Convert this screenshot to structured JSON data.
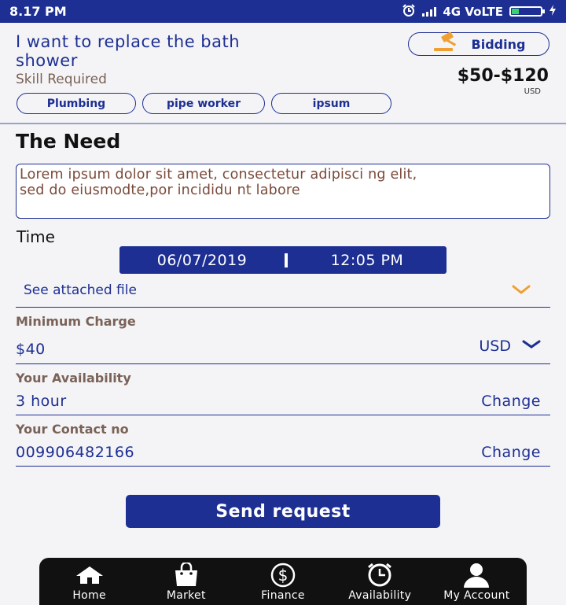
{
  "status_bar": {
    "time": "8.17 PM",
    "network": "4G VoLTE"
  },
  "job": {
    "title": "I want to replace the bath shower",
    "skill_label": "Skill Required",
    "skills": [
      "Plumbing",
      "pipe worker",
      "ipsum"
    ],
    "bidding_label": "Bidding",
    "price": "$50-$120",
    "price_currency": "USD"
  },
  "need": {
    "heading": "The Need",
    "text": "Lorem ipsum dolor sit amet, consectetur adipisci ng elit,\nsed do eiusmodte,por incididu nt labore"
  },
  "time": {
    "label": "Time",
    "date": "06/07/2019",
    "clock": "12:05 PM"
  },
  "attachment": {
    "label": "See attached file"
  },
  "minimum_charge": {
    "label": "Minimum Charge",
    "value": "$40",
    "currency": "USD"
  },
  "availability": {
    "label": "Your Availability",
    "value": "3 hour",
    "action": "Change"
  },
  "contact": {
    "label": "Your Contact no",
    "value": "009906482166",
    "action": "Change"
  },
  "send_button": "Send request",
  "nav": {
    "items": [
      {
        "label": "Home",
        "icon": "home-icon"
      },
      {
        "label": "Market",
        "icon": "shopping-bag-icon"
      },
      {
        "label": "Finance",
        "icon": "dollar-icon"
      },
      {
        "label": "Availability",
        "icon": "clock-icon"
      },
      {
        "label": "My Account",
        "icon": "user-icon"
      }
    ]
  },
  "colors": {
    "primary": "#1d2f93",
    "label_brown": "#7a6258",
    "accent_orange": "#f0a030",
    "nav_bg": "#111111"
  }
}
